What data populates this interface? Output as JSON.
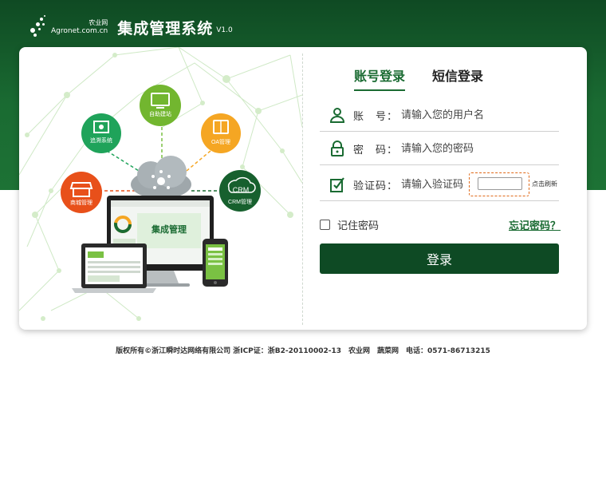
{
  "header": {
    "logo_cn": "农业网",
    "logo_en": "Agronet.com.cn",
    "title": "集成管理系统",
    "version": "V1.0"
  },
  "illustration": {
    "nodes": {
      "zizhu": "自助建站",
      "zhuisu": "追溯系统",
      "oa": "OA管理",
      "shangcheng": "商城管理",
      "crm": "CRM管理",
      "crm_logo": "CRM"
    },
    "screen_title": "集成管理"
  },
  "tabs": [
    {
      "label": "账号登录",
      "active": true
    },
    {
      "label": "短信登录",
      "active": false
    }
  ],
  "form": {
    "account_label": "账　号：",
    "account_placeholder": "请输入您的用户名",
    "password_label": "密　码：",
    "password_placeholder": "请输入您的密码",
    "captcha_label": "验证码：",
    "captcha_placeholder": "请输入验证码",
    "refresh_label": "点击刷新",
    "remember_label": "记住密码",
    "forgot_label": "忘记密码？",
    "login_label": "登录"
  },
  "footer": "版权所有©浙江瞬时达网络有限公司 浙ICP证：浙B2-20110002-13　农业网　蔬菜网　电话：0571-86713215",
  "colors": {
    "brand_dark": "#0e4a24",
    "brand": "#1a6b32",
    "accent_orange": "#e06a1a"
  }
}
